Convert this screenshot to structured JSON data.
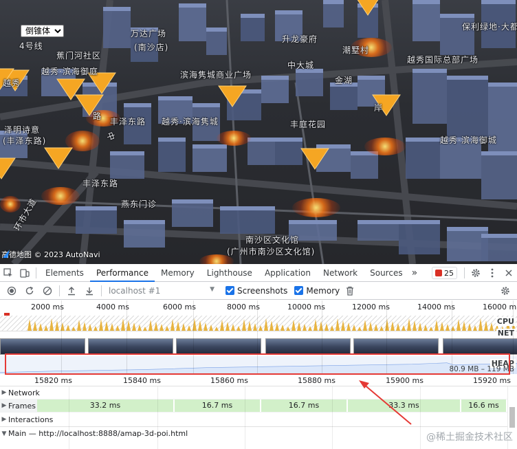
{
  "map": {
    "font_select_value": "倒锥体",
    "labels": [
      {
        "text": "万达广场",
        "dark": false
      },
      {
        "text": "万达广场",
        "dark": false
      },
      {
        "text": "(南沙店)",
        "dark": false
      },
      {
        "text": "升龙豪府",
        "dark": false
      },
      {
        "text": "保利绿地·大都汇",
        "dark": false
      },
      {
        "text": "4号线",
        "dark": false
      },
      {
        "text": "蕉门河社区",
        "dark": false
      },
      {
        "text": "潮墅村",
        "dark": false
      },
      {
        "text": "越秀·滨海御庭",
        "dark": false
      },
      {
        "text": "中大城",
        "dark": false
      },
      {
        "text": "越秀国际总部广场",
        "dark": false
      },
      {
        "text": "滨海隽城商业广场",
        "dark": false
      },
      {
        "text": "金湖",
        "dark": false
      },
      {
        "text": "越秀",
        "dark": false
      },
      {
        "text": "岸",
        "dark": false
      },
      {
        "text": "丰泽东路",
        "dark": false
      },
      {
        "text": "泽明诗意",
        "dark": false
      },
      {
        "text": "(丰泽东路)",
        "dark": false
      },
      {
        "text": "越秀·滨海隽城",
        "dark": false
      },
      {
        "text": "丰庭花园",
        "dark": false
      },
      {
        "text": "越秀·滨海御城",
        "dark": false
      },
      {
        "text": "中",
        "dark": false
      },
      {
        "text": "丰泽东路",
        "dark": false
      },
      {
        "text": "燕东门诊",
        "dark": false
      },
      {
        "text": "南沙区文化馆",
        "dark": false
      },
      {
        "text": "(广州市南沙区文化馆)",
        "dark": false
      },
      {
        "text": "环市大道",
        "dark": false
      },
      {
        "text": "路",
        "dark": false
      }
    ],
    "attribution": "高德地图 © 2023 AutoNavi"
  },
  "devtools": {
    "tabs": [
      {
        "label": "Elements",
        "active": false
      },
      {
        "label": "Performance",
        "active": true
      },
      {
        "label": "Memory",
        "active": false
      },
      {
        "label": "Lighthouse",
        "active": false
      },
      {
        "label": "Application",
        "active": false
      },
      {
        "label": "Network",
        "active": false
      },
      {
        "label": "Sources",
        "active": false
      }
    ],
    "more_tabs": "»",
    "error_count": "25",
    "toolbar": {
      "url": "localhost #1",
      "screenshots_label": "Screenshots",
      "memory_label": "Memory",
      "screenshots_checked": true,
      "memory_checked": true
    },
    "overview_ticks": [
      "2000 ms",
      "4000 ms",
      "6000 ms",
      "8000 ms",
      "10000 ms",
      "12000 ms",
      "14000 ms",
      "16000 m"
    ],
    "track_labels": {
      "cpu": "CPU",
      "net": "NET",
      "heap": "HEAP"
    },
    "heap_range": "80.9 MB – 119 MB",
    "detail_ticks": [
      "15820 ms",
      "15840 ms",
      "15860 ms",
      "15880 ms",
      "15900 ms",
      "15920 ms"
    ],
    "rows": {
      "network": "Network",
      "frames": "Frames",
      "interactions": "Interactions",
      "main": "Main — http://localhost:8888/amap-3d-poi.html"
    },
    "frame_durations": [
      "33.2 ms",
      "16.7 ms",
      "16.7 ms",
      "33.3 ms",
      "16.6 ms"
    ]
  },
  "watermark": "@稀土掘金技术社区",
  "colors": {
    "accent": "#1a73e8",
    "highlight": "#e53935",
    "poi": "#f5a623",
    "frame": "#d2f0c9",
    "cpu": "#e8b440"
  }
}
